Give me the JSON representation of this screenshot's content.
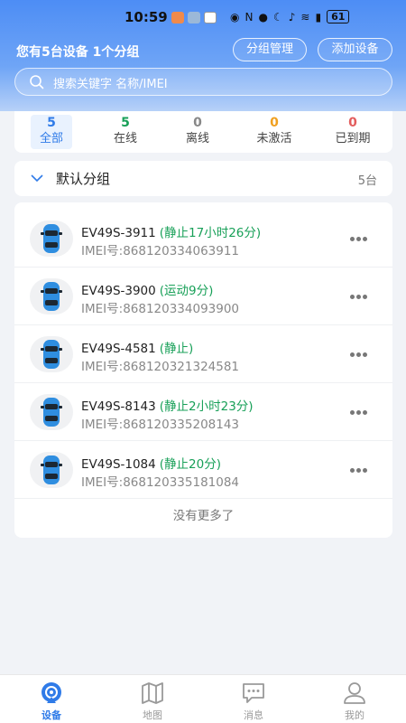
{
  "status_bar": {
    "time": "10:59",
    "battery": "61"
  },
  "header": {
    "summary": "您有5台设备 1个分组",
    "group_manage_label": "分组管理",
    "add_device_label": "添加设备",
    "search_placeholder": "搜索关键字 名称/IMEI"
  },
  "tabs": [
    {
      "count": "5",
      "label": "全部",
      "color": "#2f7be8"
    },
    {
      "count": "5",
      "label": "在线",
      "color": "#18a058"
    },
    {
      "count": "0",
      "label": "离线",
      "color": "#888888"
    },
    {
      "count": "0",
      "label": "未激活",
      "color": "#f0a020"
    },
    {
      "count": "0",
      "label": "已到期",
      "color": "#e35d5d"
    }
  ],
  "group": {
    "name": "默认分组",
    "count": "5台"
  },
  "devices": [
    {
      "name": "EV49S-3911",
      "status": "(静止17小时26分)",
      "imei": "IMEI号:868120334063911"
    },
    {
      "name": "EV49S-3900",
      "status": "(运动9分)",
      "imei": "IMEI号:868120334093900"
    },
    {
      "name": "EV49S-4581",
      "status": "(静止)",
      "imei": "IMEI号:868120321324581"
    },
    {
      "name": "EV49S-8143",
      "status": "(静止2小时23分)",
      "imei": "IMEI号:868120335208143"
    },
    {
      "name": "EV49S-1084",
      "status": "(静止20分)",
      "imei": "IMEI号:868120335181084"
    }
  ],
  "list_footer": "没有更多了",
  "bottom_nav": [
    {
      "label": "设备",
      "icon": "device-radar-icon"
    },
    {
      "label": "地图",
      "icon": "map-icon"
    },
    {
      "label": "消息",
      "icon": "message-icon"
    },
    {
      "label": "我的",
      "icon": "profile-icon"
    }
  ],
  "colors": {
    "accent": "#2f7be8",
    "header_top": "#4d8df5",
    "status_green": "#18a058"
  }
}
